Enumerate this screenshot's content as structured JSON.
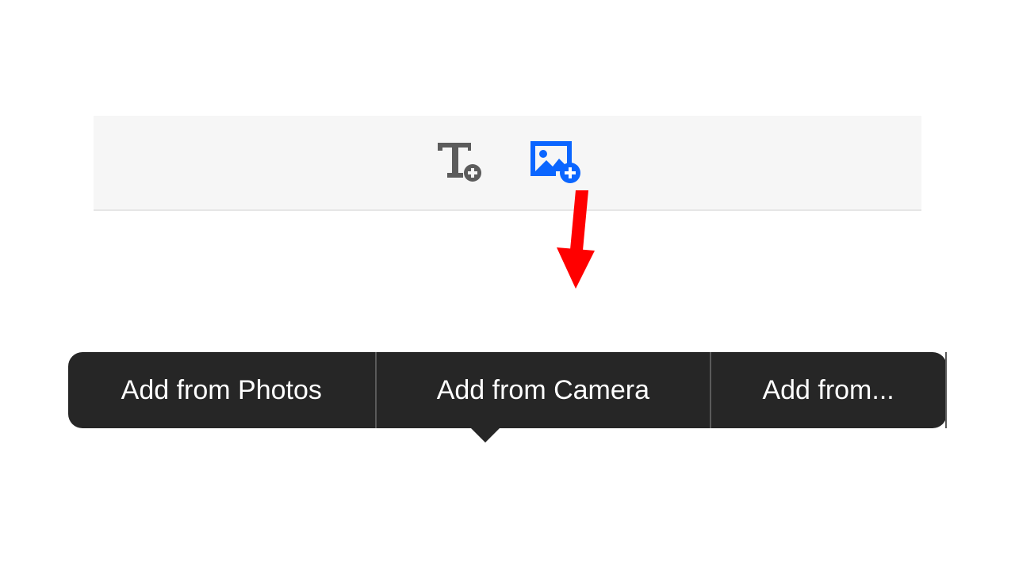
{
  "toolbar": {
    "add_text_icon": "add-text-icon",
    "add_image_icon": "add-image-icon"
  },
  "context_menu": {
    "items": [
      {
        "label": "Add from Photos"
      },
      {
        "label": "Add from Camera"
      },
      {
        "label": "Add from..."
      }
    ]
  },
  "colors": {
    "accent_blue": "#0b66ff",
    "icon_grey": "#5c5c5c",
    "menu_bg": "#262626",
    "arrow_red": "#ff0000"
  }
}
